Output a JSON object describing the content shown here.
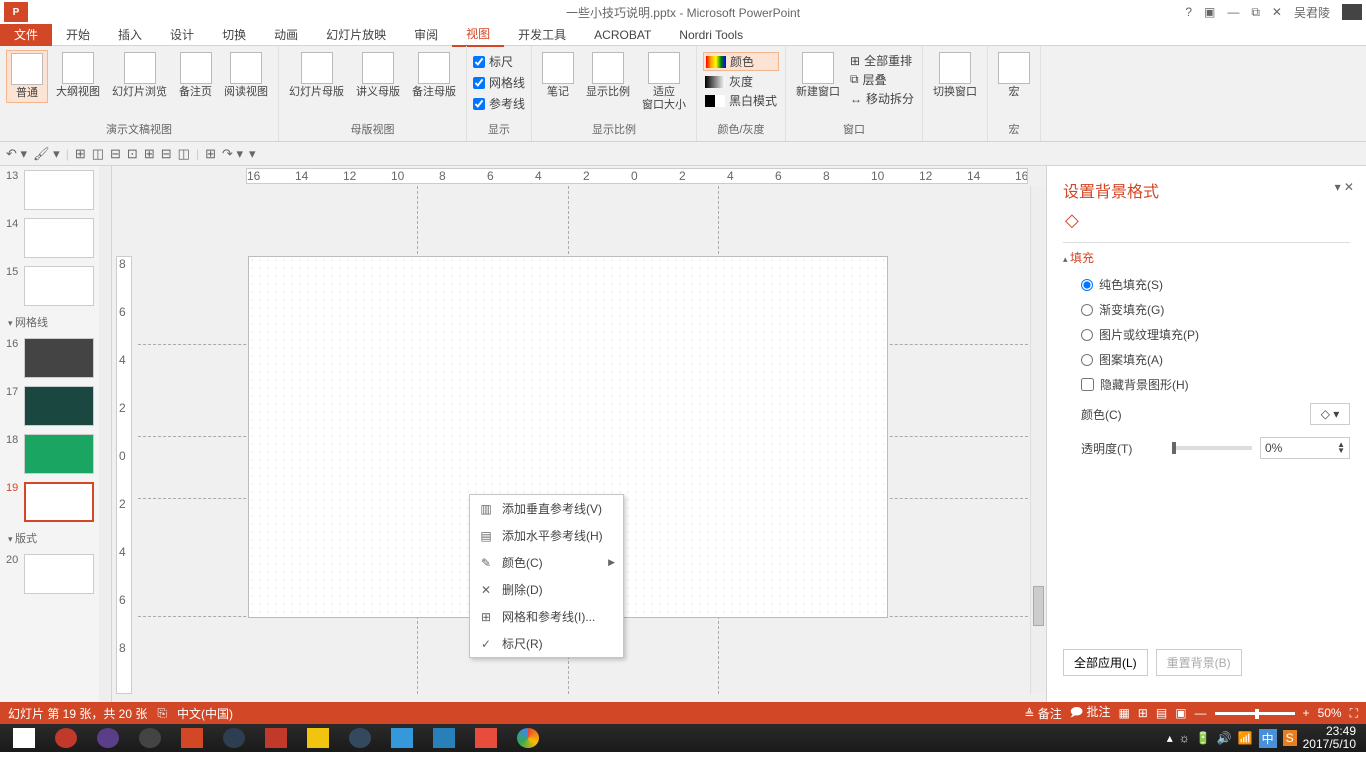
{
  "title": "一些小技巧说明.pptx - Microsoft PowerPoint",
  "user": "吴君陵",
  "window_ctrls": {
    "help": "?",
    "ribbon_opts": "▣",
    "min": "—",
    "restore": "⧉",
    "close": "✕"
  },
  "menu": {
    "file": "文件",
    "tabs": [
      "开始",
      "插入",
      "设计",
      "切换",
      "动画",
      "幻灯片放映",
      "审阅",
      "视图",
      "开发工具",
      "ACROBAT",
      "Nordri Tools"
    ],
    "active_index": 7
  },
  "ribbon": {
    "group1": {
      "label": "演示文稿视图",
      "buttons": [
        "普通",
        "大纲视图",
        "幻灯片浏览",
        "备注页",
        "阅读视图"
      ],
      "active": 0
    },
    "group2": {
      "label": "母版视图",
      "buttons": [
        "幻灯片母版",
        "讲义母版",
        "备注母版"
      ]
    },
    "group3": {
      "label": "显示",
      "checks": [
        "标尺",
        "网格线",
        "参考线"
      ]
    },
    "group4": {
      "label": "显示比例",
      "buttons": [
        "笔记",
        "显示比例",
        "适应\n窗口大小"
      ]
    },
    "group5": {
      "label": "颜色/灰度",
      "items": [
        "颜色",
        "灰度",
        "黑白模式"
      ]
    },
    "group6": {
      "label": "窗口",
      "new_window": "新建窗口",
      "items": [
        "全部重排",
        "层叠",
        "移动拆分"
      ]
    },
    "group7": {
      "label": "",
      "btn": "切换窗口"
    },
    "group8": {
      "label": "宏",
      "btn": "宏"
    }
  },
  "thumbs": {
    "section_grid": "网格线",
    "section_layout": "版式",
    "numbers": [
      "13",
      "14",
      "15",
      "16",
      "17",
      "18",
      "19",
      "20"
    ],
    "active": "19"
  },
  "ruler_h": [
    "16",
    "14",
    "12",
    "10",
    "8",
    "6",
    "4",
    "2",
    "0",
    "2",
    "4",
    "6",
    "8",
    "10",
    "12",
    "14",
    "16"
  ],
  "ruler_v": [
    "8",
    "6",
    "4",
    "2",
    "0",
    "2",
    "4",
    "6",
    "8"
  ],
  "context_menu": {
    "items": [
      {
        "icon": "▥",
        "label": "添加垂直参考线(V)"
      },
      {
        "icon": "▤",
        "label": "添加水平参考线(H)"
      },
      {
        "icon": "✎",
        "label": "颜色(C)",
        "submenu": true
      },
      {
        "icon": "✕",
        "label": "删除(D)"
      },
      {
        "icon": "⊞",
        "label": "网格和参考线(I)..."
      },
      {
        "icon": "✓",
        "label": "标尺(R)"
      }
    ]
  },
  "format_pane": {
    "title": "设置背景格式",
    "section": "填充",
    "radios": [
      "纯色填充(S)",
      "渐变填充(G)",
      "图片或纹理填充(P)",
      "图案填充(A)"
    ],
    "selected_radio": 0,
    "hide_bg": "隐藏背景图形(H)",
    "color_label": "颜色(C)",
    "transparency_label": "透明度(T)",
    "transparency_value": "0%",
    "apply_all": "全部应用(L)",
    "reset_bg": "重置背景(B)"
  },
  "status": {
    "slide_info": "幻灯片 第 19 张，共 20 张",
    "lang": "中文(中国)",
    "notes": "备注",
    "comments": "批注",
    "zoom": "50%"
  },
  "taskbar": {
    "time": "23:49",
    "date": "2017/5/10"
  }
}
